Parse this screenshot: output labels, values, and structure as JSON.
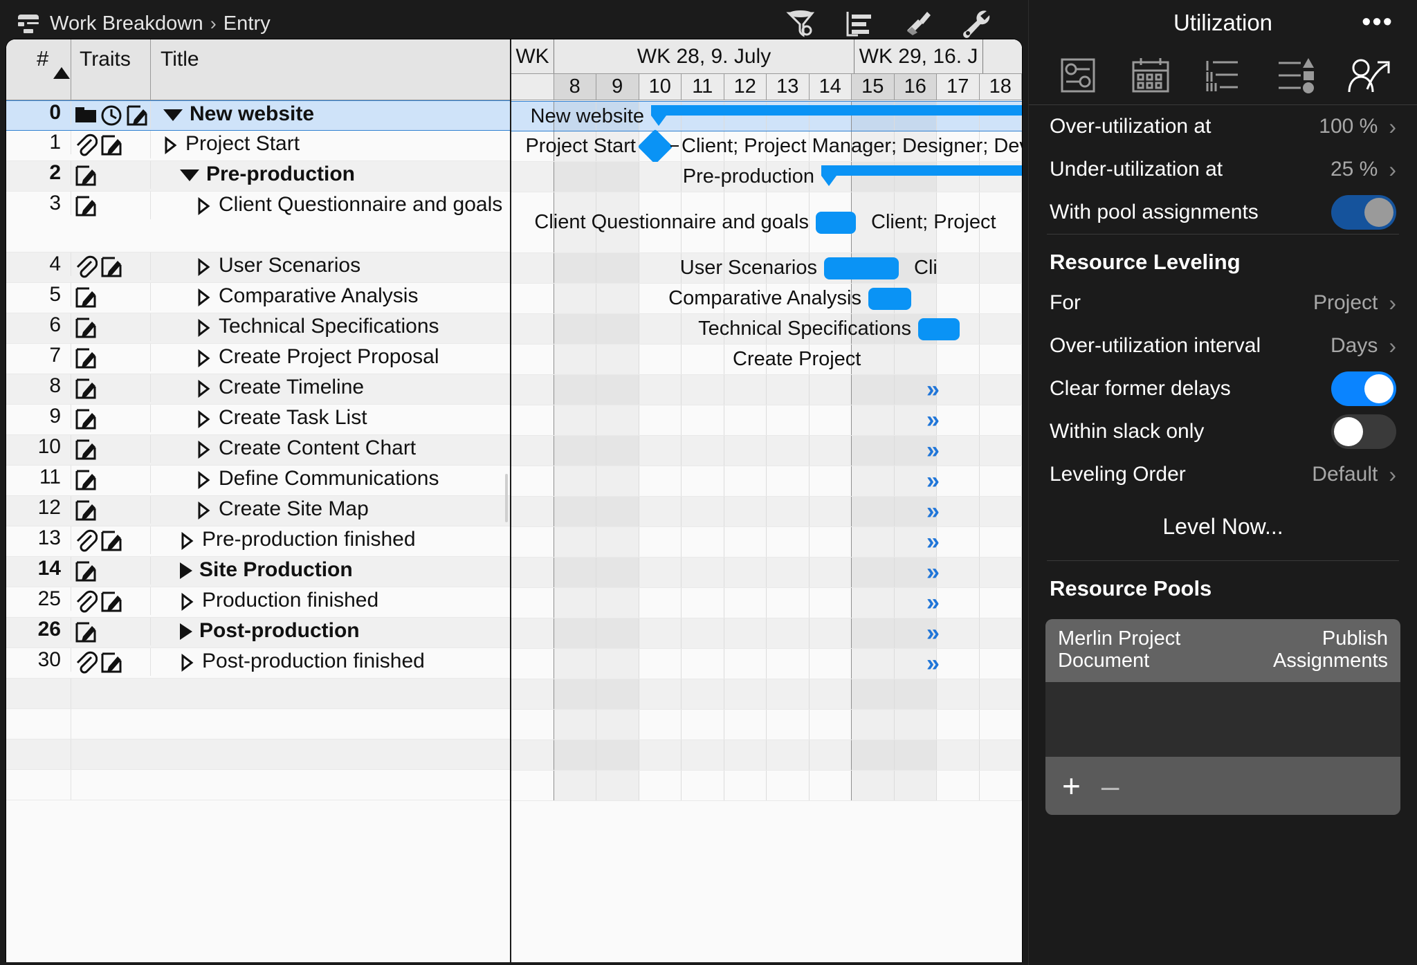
{
  "breadcrumb": {
    "root": "Work Breakdown",
    "separator": "›",
    "leaf": "Entry",
    "icon": "work-breakdown-icon"
  },
  "toolbar": [
    {
      "name": "filter-icon",
      "label": "Filter"
    },
    {
      "name": "outline-icon",
      "label": "Outline"
    },
    {
      "name": "paintbrush-icon",
      "label": "Styles"
    },
    {
      "name": "wrench-icon",
      "label": "Settings"
    }
  ],
  "table": {
    "columns": [
      "#",
      "Traits",
      "Title"
    ],
    "sort_indicator": "▲",
    "rows": [
      {
        "num": "0",
        "traits": [
          "folder-icon",
          "clock-icon",
          "notes-icon"
        ],
        "indent": 0,
        "disclosure": "down",
        "title": "New website",
        "bold": true,
        "selected": true
      },
      {
        "num": "1",
        "traits": [
          "attachment-icon",
          "notes-icon"
        ],
        "indent": 0,
        "disclosure": "right-hollow",
        "title": "Project Start",
        "bold": false,
        "selected": false
      },
      {
        "num": "2",
        "traits": [
          "notes-icon"
        ],
        "indent": 1,
        "disclosure": "down",
        "title": "Pre-production",
        "bold": true,
        "selected": false
      },
      {
        "num": "3",
        "traits": [
          "notes-icon"
        ],
        "indent": 2,
        "disclosure": "right-hollow",
        "title": "Client Questionnaire and goals",
        "bold": false,
        "selected": false
      },
      {
        "num": "4",
        "traits": [
          "attachment-icon",
          "notes-icon"
        ],
        "indent": 2,
        "disclosure": "right-hollow",
        "title": "User Scenarios",
        "bold": false,
        "selected": false
      },
      {
        "num": "5",
        "traits": [
          "notes-icon"
        ],
        "indent": 2,
        "disclosure": "right-hollow",
        "title": "Comparative Analysis",
        "bold": false,
        "selected": false
      },
      {
        "num": "6",
        "traits": [
          "notes-icon"
        ],
        "indent": 2,
        "disclosure": "right-hollow",
        "title": "Technical Specifications",
        "bold": false,
        "selected": false
      },
      {
        "num": "7",
        "traits": [
          "notes-icon"
        ],
        "indent": 2,
        "disclosure": "right-hollow",
        "title": "Create Project Proposal",
        "bold": false,
        "selected": false
      },
      {
        "num": "8",
        "traits": [
          "notes-icon"
        ],
        "indent": 2,
        "disclosure": "right-hollow",
        "title": "Create Timeline",
        "bold": false,
        "selected": false
      },
      {
        "num": "9",
        "traits": [
          "notes-icon"
        ],
        "indent": 2,
        "disclosure": "right-hollow",
        "title": "Create Task List",
        "bold": false,
        "selected": false
      },
      {
        "num": "10",
        "traits": [
          "notes-icon"
        ],
        "indent": 2,
        "disclosure": "right-hollow",
        "title": "Create Content Chart",
        "bold": false,
        "selected": false
      },
      {
        "num": "11",
        "traits": [
          "notes-icon"
        ],
        "indent": 2,
        "disclosure": "right-hollow",
        "title": "Define Communications",
        "bold": false,
        "selected": false
      },
      {
        "num": "12",
        "traits": [
          "notes-icon"
        ],
        "indent": 2,
        "disclosure": "right-hollow",
        "title": "Create Site Map",
        "bold": false,
        "selected": false
      },
      {
        "num": "13",
        "traits": [
          "attachment-icon",
          "notes-icon"
        ],
        "indent": 1,
        "disclosure": "right-hollow",
        "title": "Pre-production finished",
        "bold": false,
        "selected": false
      },
      {
        "num": "14",
        "traits": [
          "notes-icon"
        ],
        "indent": 1,
        "disclosure": "right-solid",
        "title": "Site Production",
        "bold": true,
        "selected": false
      },
      {
        "num": "25",
        "traits": [
          "attachment-icon",
          "notes-icon"
        ],
        "indent": 1,
        "disclosure": "right-hollow",
        "title": "Production finished",
        "bold": false,
        "selected": false
      },
      {
        "num": "26",
        "traits": [
          "notes-icon"
        ],
        "indent": 1,
        "disclosure": "right-solid",
        "title": "Post-production",
        "bold": true,
        "selected": false
      },
      {
        "num": "30",
        "traits": [
          "attachment-icon",
          "notes-icon"
        ],
        "indent": 1,
        "disclosure": "right-hollow",
        "title": "Post-production finished",
        "bold": false,
        "selected": false
      }
    ]
  },
  "gantt": {
    "wk_column_label": "WK",
    "week_headers": [
      {
        "label": "WK 28, 9. July",
        "days": 7
      },
      {
        "label": "WK 29, 16. J",
        "days": 3
      }
    ],
    "days": [
      {
        "n": "8",
        "off": true
      },
      {
        "n": "9",
        "off": true
      },
      {
        "n": "10",
        "off": false
      },
      {
        "n": "11",
        "off": false
      },
      {
        "n": "12",
        "off": false
      },
      {
        "n": "13",
        "off": false
      },
      {
        "n": "14",
        "off": false
      },
      {
        "n": "15",
        "off": true
      },
      {
        "n": "16",
        "off": true
      },
      {
        "n": "17",
        "off": false
      },
      {
        "n": "18",
        "off": false
      }
    ],
    "bar_rows": [
      {
        "type": "summary",
        "label": "New website",
        "label_side": "left",
        "resources": ""
      },
      {
        "type": "milestone",
        "label": "Project Start",
        "label_side": "left",
        "resources": "Client; Project Manager; Designer; Develo"
      },
      {
        "type": "summary",
        "label": "Pre-production",
        "label_side": "left",
        "resources": ""
      },
      {
        "type": "task",
        "label": "Client Questionnaire and goals",
        "label_side": "left",
        "resources": "Client; Project"
      },
      {
        "type": "task",
        "label": "User Scenarios",
        "label_side": "left",
        "resources": "Cli"
      },
      {
        "type": "task",
        "label": "Comparative Analysis",
        "label_side": "left",
        "resources": ""
      },
      {
        "type": "task",
        "label": "Technical Specifications",
        "label_side": "left",
        "resources": ""
      },
      {
        "type": "offscreen",
        "label": "Create Project",
        "label_side": "left",
        "resources": ""
      },
      {
        "type": "chevron",
        "label": "»",
        "label_side": "",
        "resources": ""
      },
      {
        "type": "chevron",
        "label": "»",
        "label_side": "",
        "resources": ""
      },
      {
        "type": "chevron",
        "label": "»",
        "label_side": "",
        "resources": ""
      },
      {
        "type": "chevron",
        "label": "»",
        "label_side": "",
        "resources": ""
      },
      {
        "type": "chevron",
        "label": "»",
        "label_side": "",
        "resources": ""
      },
      {
        "type": "chevron",
        "label": "»",
        "label_side": "",
        "resources": ""
      },
      {
        "type": "chevron",
        "label": "»",
        "label_side": "",
        "resources": ""
      },
      {
        "type": "chevron",
        "label": "»",
        "label_side": "",
        "resources": ""
      },
      {
        "type": "chevron",
        "label": "»",
        "label_side": "",
        "resources": ""
      },
      {
        "type": "chevron",
        "label": "»",
        "label_side": "",
        "resources": ""
      }
    ],
    "accent_color": "#0a93f5",
    "chevron_color": "#1f75d8"
  },
  "inspector": {
    "title": "Utilization",
    "overflow_menu": "•••",
    "tabs": [
      {
        "name": "settings-sliders-icon",
        "active": false
      },
      {
        "name": "calendar-icon",
        "active": false
      },
      {
        "name": "outline-list-icon",
        "active": false
      },
      {
        "name": "priority-list-icon",
        "active": false
      },
      {
        "name": "resource-person-icon",
        "active": true
      }
    ],
    "utilization": [
      {
        "label": "Over-utilization at",
        "value": "100 %",
        "kind": "disclosure"
      },
      {
        "label": "Under-utilization at",
        "value": "25 %",
        "kind": "disclosure"
      },
      {
        "label": "With pool assignments",
        "value": "",
        "kind": "toggle",
        "state": "on-dim"
      }
    ],
    "leveling_section_title": "Resource Leveling",
    "leveling": [
      {
        "label": "For",
        "value": "Project",
        "kind": "disclosure"
      },
      {
        "label": "Over-utilization interval",
        "value": "Days",
        "kind": "disclosure"
      },
      {
        "label": "Clear former delays",
        "value": "",
        "kind": "toggle",
        "state": "on"
      },
      {
        "label": "Within slack only",
        "value": "",
        "kind": "toggle",
        "state": "off"
      },
      {
        "label": "Leveling Order",
        "value": "Default",
        "kind": "disclosure"
      }
    ],
    "level_now_label": "Level Now...",
    "pools_section_title": "Resource Pools",
    "pool_rows": [
      {
        "name": "Merlin Project Document",
        "right": "Publish Assignments"
      }
    ],
    "pool_add": "+",
    "pool_remove": "–",
    "accent_color": "#0a84ff"
  }
}
